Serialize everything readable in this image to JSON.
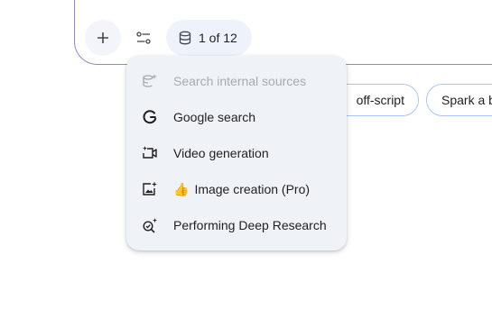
{
  "toolbar": {
    "add_icon": "plus-icon",
    "tools_icon": "tune-sliders-icon",
    "sources_icon": "database-icon",
    "sources_label": "1 of 12"
  },
  "chips": [
    {
      "label": "off-script"
    },
    {
      "label": "Spark a b"
    }
  ],
  "menu": {
    "items": [
      {
        "label": "Search internal sources",
        "icon": "database-sparkle-icon",
        "disabled": true
      },
      {
        "label": "Google search",
        "icon": "google-g-icon",
        "disabled": false
      },
      {
        "label": "Video generation",
        "icon": "video-sparkle-icon",
        "disabled": false
      },
      {
        "label": "Image creation (Pro)",
        "prefix_emoji": "👍",
        "icon": "image-sparkle-icon",
        "disabled": false
      },
      {
        "label": "Performing Deep Research",
        "icon": "deep-research-icon",
        "disabled": false
      }
    ]
  },
  "colors": {
    "composer_border": "#8f88d8",
    "chip_border": "#a8c7fa",
    "menu_bg": "#eff2f6",
    "disabled_text": "#a7abb2"
  }
}
